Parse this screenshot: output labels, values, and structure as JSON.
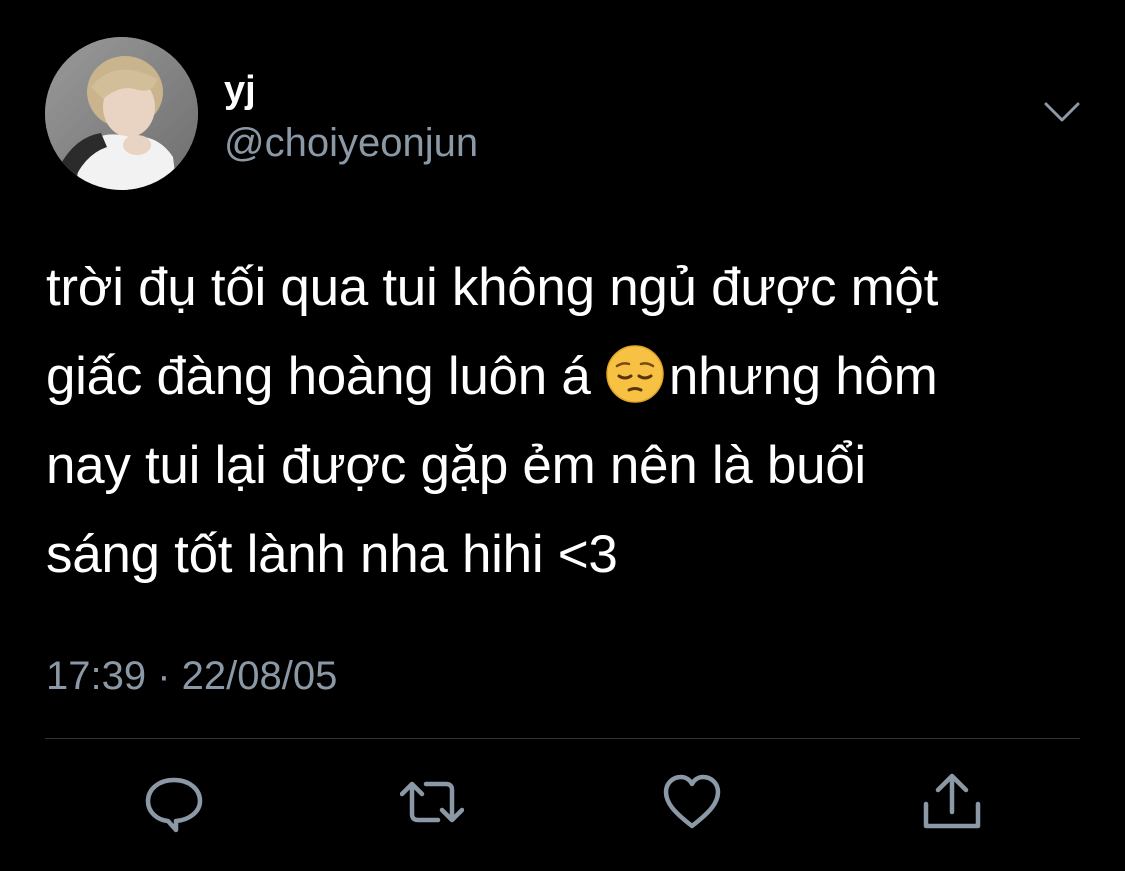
{
  "user": {
    "display_name": "yj",
    "handle": "@choiyeonjun",
    "avatar": "profile-photo"
  },
  "tweet": {
    "lines": [
      "trời đụ tối qua tui không ngủ được một",
      "giấc đàng hoàng luôn á ",
      "nhưng hôm",
      "nay tui lại được gặp ẻm nên là buổi",
      "sáng tốt lành nha hihi <3"
    ],
    "emoji": "pensive-face",
    "timestamp": "17:39 · 22/08/05"
  },
  "actions": [
    "reply-icon",
    "retweet-icon",
    "like-icon",
    "share-icon"
  ],
  "colors": {
    "background": "#000000",
    "text": "#ffffff",
    "secondary_text": "#8b98a5",
    "divider": "#2f3336",
    "icon": "#8b98a5"
  }
}
